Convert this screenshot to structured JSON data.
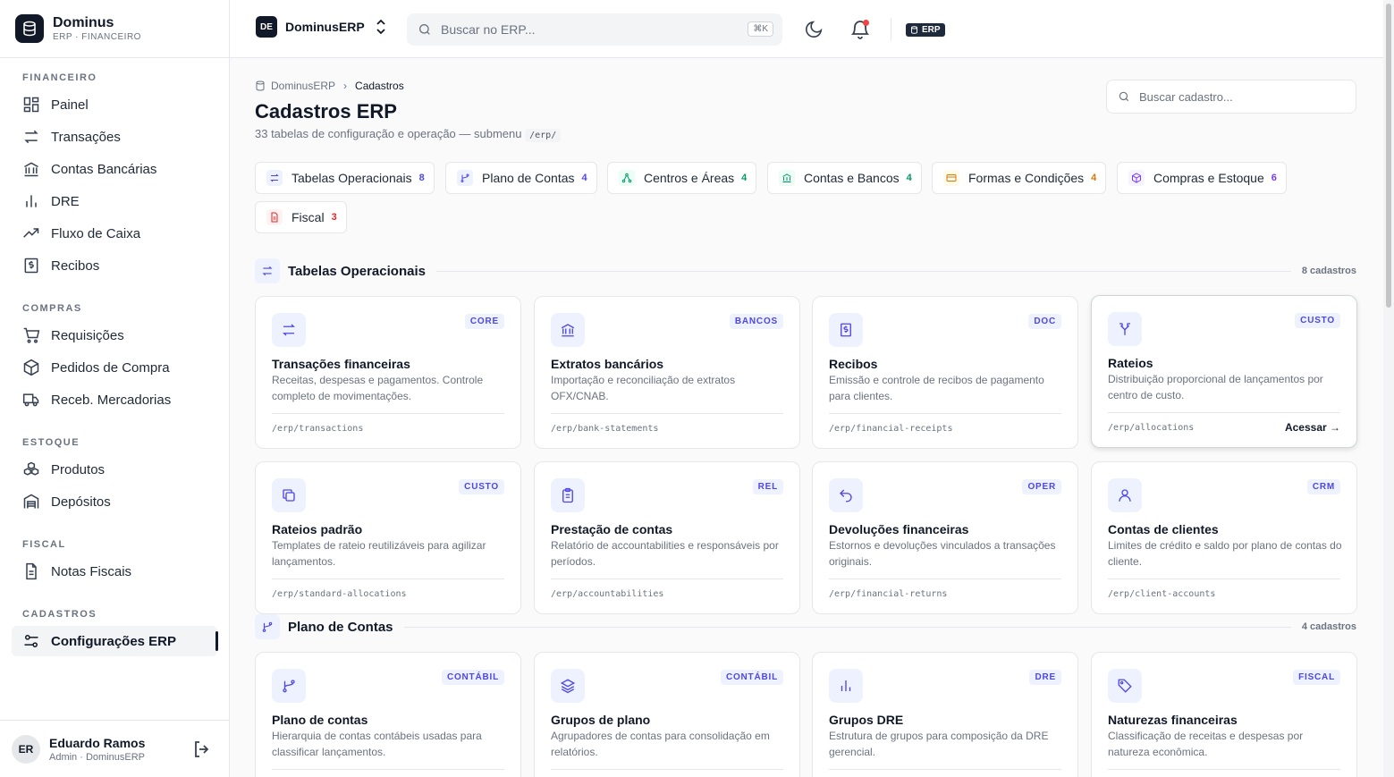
{
  "brand": {
    "name": "Dominus",
    "sub": "ERP · FINANCEIRO"
  },
  "sidebar": {
    "sections": [
      {
        "label": "FINANCEIRO",
        "items": [
          {
            "label": "Painel",
            "icon": "grid-icon"
          },
          {
            "label": "Transações",
            "icon": "arrows-icon"
          },
          {
            "label": "Contas Bancárias",
            "icon": "bank-icon"
          },
          {
            "label": "DRE",
            "icon": "chart-icon"
          },
          {
            "label": "Fluxo de Caixa",
            "icon": "trend-icon"
          },
          {
            "label": "Recibos",
            "icon": "receipt-icon"
          }
        ]
      },
      {
        "label": "COMPRAS",
        "items": [
          {
            "label": "Requisições",
            "icon": "cart-icon"
          },
          {
            "label": "Pedidos de Compra",
            "icon": "box-icon"
          },
          {
            "label": "Receb. Mercadorias",
            "icon": "truck-icon"
          }
        ]
      },
      {
        "label": "ESTOQUE",
        "items": [
          {
            "label": "Produtos",
            "icon": "boxes-icon"
          },
          {
            "label": "Depósitos",
            "icon": "warehouse-icon"
          }
        ]
      },
      {
        "label": "FISCAL",
        "items": [
          {
            "label": "Notas Fiscais",
            "icon": "document-icon"
          }
        ]
      },
      {
        "label": "CADASTROS",
        "items": [
          {
            "label": "Configurações ERP",
            "icon": "sliders-icon",
            "active": true
          }
        ]
      }
    ]
  },
  "user": {
    "initials": "ER",
    "name": "Eduardo Ramos",
    "role": "Admin · DominusERP"
  },
  "topbar": {
    "workspace_badge": "DE",
    "workspace": "DominusERP",
    "search_placeholder": "Buscar no ERP...",
    "shortcut": "⌘K",
    "env_badge": "ERP"
  },
  "page": {
    "breadcrumb": [
      "DominusERP",
      "Cadastros"
    ],
    "title": "Cadastros ERP",
    "subtitle": "33 tabelas de configuração e operação — submenu",
    "subtitle_code": "/erp/",
    "search_placeholder": "Buscar cadastro..."
  },
  "chips": [
    {
      "label": "Tabelas Operacionais",
      "count": "8",
      "color": "#4f46e5"
    },
    {
      "label": "Plano de Contas",
      "count": "4",
      "color": "#4f46e5"
    },
    {
      "label": "Centros e Áreas",
      "count": "4",
      "color": "#059669"
    },
    {
      "label": "Contas e Bancos",
      "count": "4",
      "color": "#059669"
    },
    {
      "label": "Formas e Condições",
      "count": "4",
      "color": "#d97706"
    },
    {
      "label": "Compras e Estoque",
      "count": "6",
      "color": "#7c3aed"
    },
    {
      "label": "Fiscal",
      "count": "3",
      "color": "#dc2626"
    }
  ],
  "sections": [
    {
      "title": "Tabelas Operacionais",
      "count": "8 cadastros"
    },
    {
      "title": "Plano de Contas",
      "count": "4 cadastros"
    }
  ],
  "cards": [
    {
      "tag": "CORE",
      "title": "Transações financeiras",
      "desc": "Receitas, despesas e pagamentos. Controle completo de movimentações.",
      "path": "/erp/transactions",
      "icon": "arrows-icon"
    },
    {
      "tag": "BANCOS",
      "title": "Extratos bancários",
      "desc": "Importação e reconciliação de extratos OFX/CNAB.",
      "path": "/erp/bank-statements",
      "icon": "bank-icon"
    },
    {
      "tag": "DOC",
      "title": "Recibos",
      "desc": "Emissão e controle de recibos de pagamento para clientes.",
      "path": "/erp/financial-receipts",
      "icon": "receipt-icon"
    },
    {
      "tag": "CUSTO",
      "title": "Rateios",
      "desc": "Distribuição proporcional de lançamentos por centro de custo.",
      "path": "/erp/allocations",
      "icon": "split-icon",
      "action": "Acessar →"
    },
    {
      "tag": "CUSTO",
      "title": "Rateios padrão",
      "desc": "Templates de rateio reutilizáveis para agilizar lançamentos.",
      "path": "/erp/standard-allocations",
      "icon": "copy-icon"
    },
    {
      "tag": "REL",
      "title": "Prestação de contas",
      "desc": "Relatório de accountabilities e responsáveis por períodos.",
      "path": "/erp/accountabilities",
      "icon": "clipboard-icon"
    },
    {
      "tag": "OPER",
      "title": "Devoluções financeiras",
      "desc": "Estornos e devoluções vinculados a transações originais.",
      "path": "/erp/financial-returns",
      "icon": "undo-icon"
    },
    {
      "tag": "CRM",
      "title": "Contas de clientes",
      "desc": "Limites de crédito e saldo por plano de contas do cliente.",
      "path": "/erp/client-accounts",
      "icon": "user-icon"
    },
    {
      "tag": "CONTÁBIL",
      "title": "Plano de contas",
      "desc": "Hierarquia de contas contábeis usadas para classificar lançamentos.",
      "path": "",
      "icon": "branch-icon"
    },
    {
      "tag": "CONTÁBIL",
      "title": "Grupos de plano",
      "desc": "Agrupadores de contas para consolidação em relatórios.",
      "path": "",
      "icon": "layers-icon"
    },
    {
      "tag": "DRE",
      "title": "Grupos DRE",
      "desc": "Estrutura de grupos para composição da DRE gerencial.",
      "path": "",
      "icon": "chart-icon"
    },
    {
      "tag": "FISCAL",
      "title": "Naturezas financeiras",
      "desc": "Classificação de receitas e despesas por natureza econômica.",
      "path": "",
      "icon": "tag-icon"
    }
  ]
}
